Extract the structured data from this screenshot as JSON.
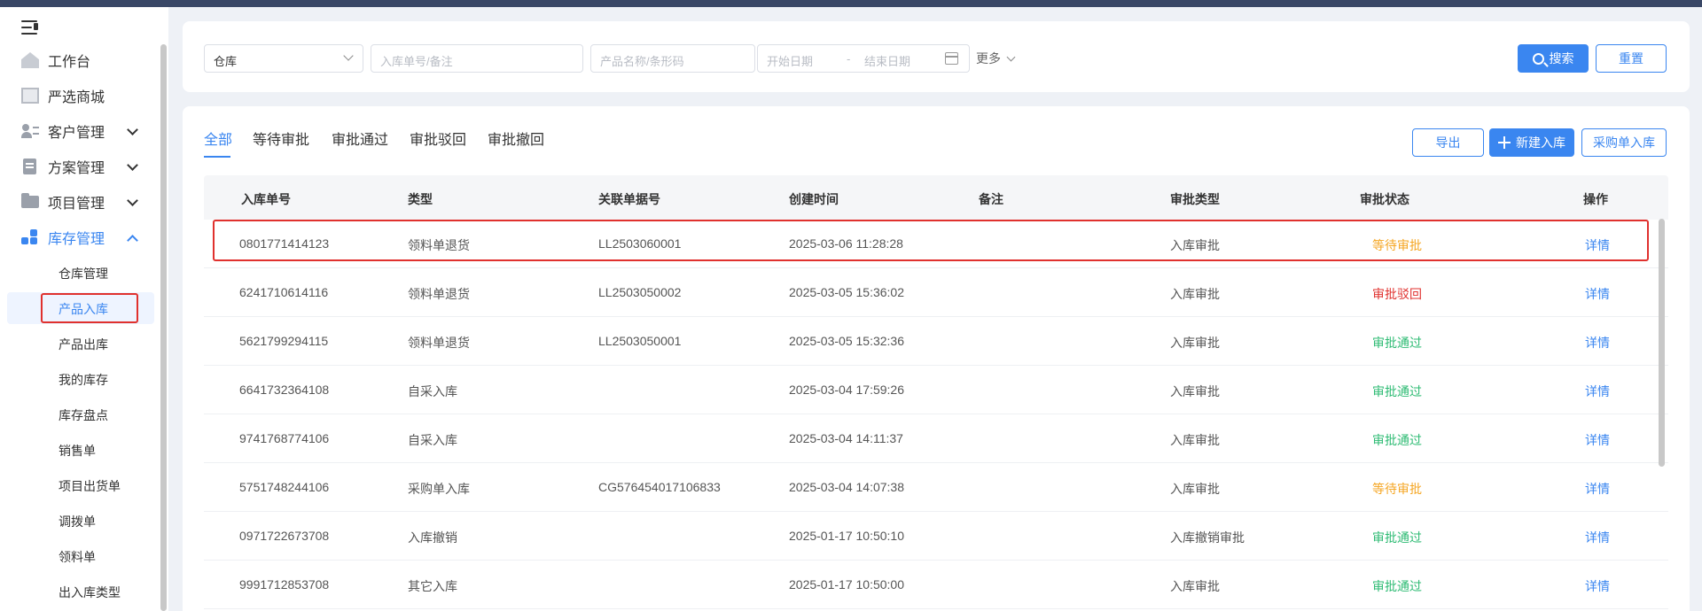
{
  "sidebar": {
    "menu": [
      {
        "label": "工作台"
      },
      {
        "label": "严选商城"
      },
      {
        "label": "客户管理"
      },
      {
        "label": "方案管理"
      },
      {
        "label": "项目管理"
      },
      {
        "label": "库存管理"
      }
    ],
    "sub": [
      "仓库管理",
      "产品入库",
      "产品出库",
      "我的库存",
      "库存盘点",
      "销售单",
      "项目出货单",
      "调拨单",
      "领料单",
      "出入库类型"
    ]
  },
  "filters": {
    "warehouse": "仓库",
    "inbound_ph": "入库单号/备注",
    "product_ph": "产品名称/条形码",
    "start_ph": "开始日期",
    "date_sep": "-",
    "end_ph": "结束日期",
    "more": "更多",
    "search": "搜索",
    "reset": "重置"
  },
  "tabs": [
    "全部",
    "等待审批",
    "审批通过",
    "审批驳回",
    "审批撤回"
  ],
  "actions": {
    "export": "导出",
    "new": "新建入库",
    "purchase": "采购单入库"
  },
  "columns": [
    "入库单号",
    "类型",
    "关联单据号",
    "创建时间",
    "备注",
    "审批类型",
    "审批状态",
    "操作"
  ],
  "rows": [
    {
      "no": "0801771414123",
      "type": "领料单退货",
      "ref": "LL2503060001",
      "time": "2025-03-06 11:28:28",
      "note": "",
      "atype": "入库审批",
      "status": "等待审批",
      "op": "详情"
    },
    {
      "no": "6241710614116",
      "type": "领料单退货",
      "ref": "LL2503050002",
      "time": "2025-03-05 15:36:02",
      "note": "",
      "atype": "入库审批",
      "status": "审批驳回",
      "op": "详情"
    },
    {
      "no": "5621799294115",
      "type": "领料单退货",
      "ref": "LL2503050001",
      "time": "2025-03-05 15:32:36",
      "note": "",
      "atype": "入库审批",
      "status": "审批通过",
      "op": "详情"
    },
    {
      "no": "6641732364108",
      "type": "自采入库",
      "ref": "",
      "time": "2025-03-04 17:59:26",
      "note": "",
      "atype": "入库审批",
      "status": "审批通过",
      "op": "详情"
    },
    {
      "no": "9741768774106",
      "type": "自采入库",
      "ref": "",
      "time": "2025-03-04 14:11:37",
      "note": "",
      "atype": "入库审批",
      "status": "审批通过",
      "op": "详情"
    },
    {
      "no": "5751748244106",
      "type": "采购单入库",
      "ref": "CG576454017106833",
      "time": "2025-03-04 14:07:38",
      "note": "",
      "atype": "入库审批",
      "status": "等待审批",
      "op": "详情"
    },
    {
      "no": "0971722673708",
      "type": "入库撤销",
      "ref": "",
      "time": "2025-01-17 10:50:10",
      "note": "",
      "atype": "入库撤销审批",
      "status": "审批通过",
      "op": "详情"
    },
    {
      "no": "9991712853708",
      "type": "其它入库",
      "ref": "",
      "time": "2025-01-17 10:50:00",
      "note": "",
      "atype": "入库审批",
      "status": "审批通过",
      "op": "详情"
    }
  ],
  "colors": {
    "primary": "#3a86f0",
    "wait": "#f5a623",
    "reject": "#e0312e",
    "pass": "#2dbb73"
  }
}
